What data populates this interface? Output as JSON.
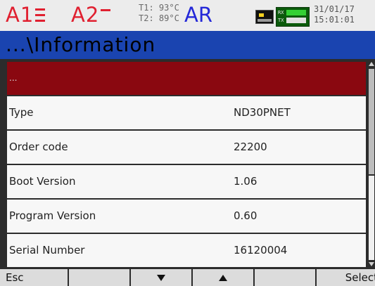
{
  "status": {
    "alarm1": "A1",
    "alarm2": "A2",
    "temp1": "T1: 93°C",
    "temp2": "T2: 89°C",
    "mode": "AR",
    "net_rx": "RX",
    "net_tx": "TX",
    "date": "31/01/17",
    "time": "15:01:01",
    "icons": [
      "monitor-icon",
      "network-icon"
    ],
    "colors": {
      "alarm": "#e02030",
      "mode": "#2428d8",
      "title_bar": "#1a44b0",
      "selected_row": "#8a0810"
    }
  },
  "title": "...\\Information",
  "list": {
    "selected_label": "...",
    "rows": [
      {
        "label": "Type",
        "value": "ND30PNET"
      },
      {
        "label": "Order code",
        "value": "22200"
      },
      {
        "label": "Boot Version",
        "value": "1.06"
      },
      {
        "label": "Program Version",
        "value": "0.60"
      },
      {
        "label": "Serial Number",
        "value": "16120004"
      }
    ]
  },
  "fkeys": {
    "f1": "Esc",
    "f2": "",
    "f3_icon": "arrow-down-icon",
    "f4_icon": "arrow-up-icon",
    "f5": "",
    "f6": "Select"
  }
}
